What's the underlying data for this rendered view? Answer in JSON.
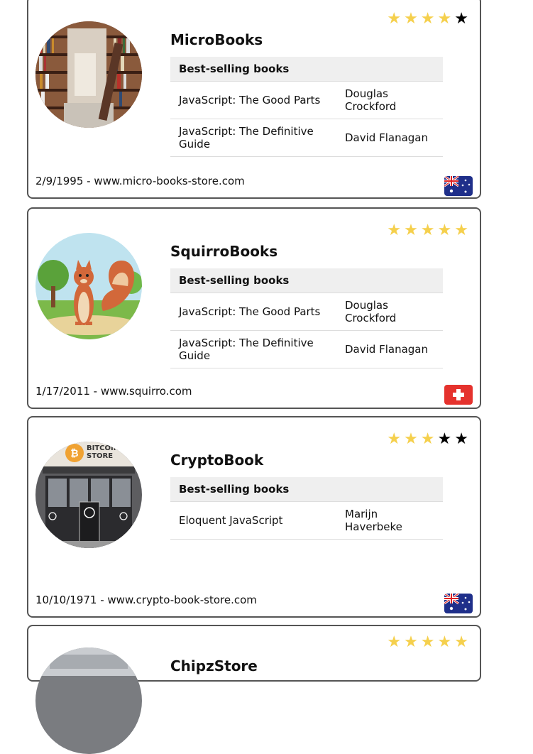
{
  "stores": [
    {
      "name": "MicroBooks",
      "rating": 4,
      "avatar": "bookshelf-photo",
      "table_header": "Best-selling books",
      "books": [
        {
          "title": "JavaScript: The Good Parts",
          "author": "Douglas Crockford"
        },
        {
          "title": "JavaScript: The Definitive Guide",
          "author": "David Flanagan"
        }
      ],
      "footer": "2/9/1995 - www.micro-books-store.com",
      "flag": "australia-flag"
    },
    {
      "name": "SquirroBooks",
      "rating": 5,
      "avatar": "squirrel-illustration",
      "table_header": "Best-selling books",
      "books": [
        {
          "title": "JavaScript: The Good Parts",
          "author": "Douglas Crockford"
        },
        {
          "title": "JavaScript: The Definitive Guide",
          "author": "David Flanagan"
        }
      ],
      "footer": "1/17/2011 - www.squirro.com",
      "flag": "switzerland-flag"
    },
    {
      "name": "CryptoBook",
      "rating": 3,
      "avatar": "bitcoin-store-photo",
      "avatar_sign": "BITCOIN STORE",
      "table_header": "Best-selling books",
      "books": [
        {
          "title": "Eloquent JavaScript",
          "author": "Marijn Haverbeke"
        }
      ],
      "footer": "10/10/1971 - www.crypto-book-store.com",
      "flag": "australia-flag"
    },
    {
      "name": "ChipzStore",
      "rating": 5,
      "avatar": "store-photo"
    }
  ],
  "star_glyph": "★",
  "colors": {
    "star_on": "#f5d04d",
    "star_off": "#000000",
    "card_border": "#555555"
  }
}
